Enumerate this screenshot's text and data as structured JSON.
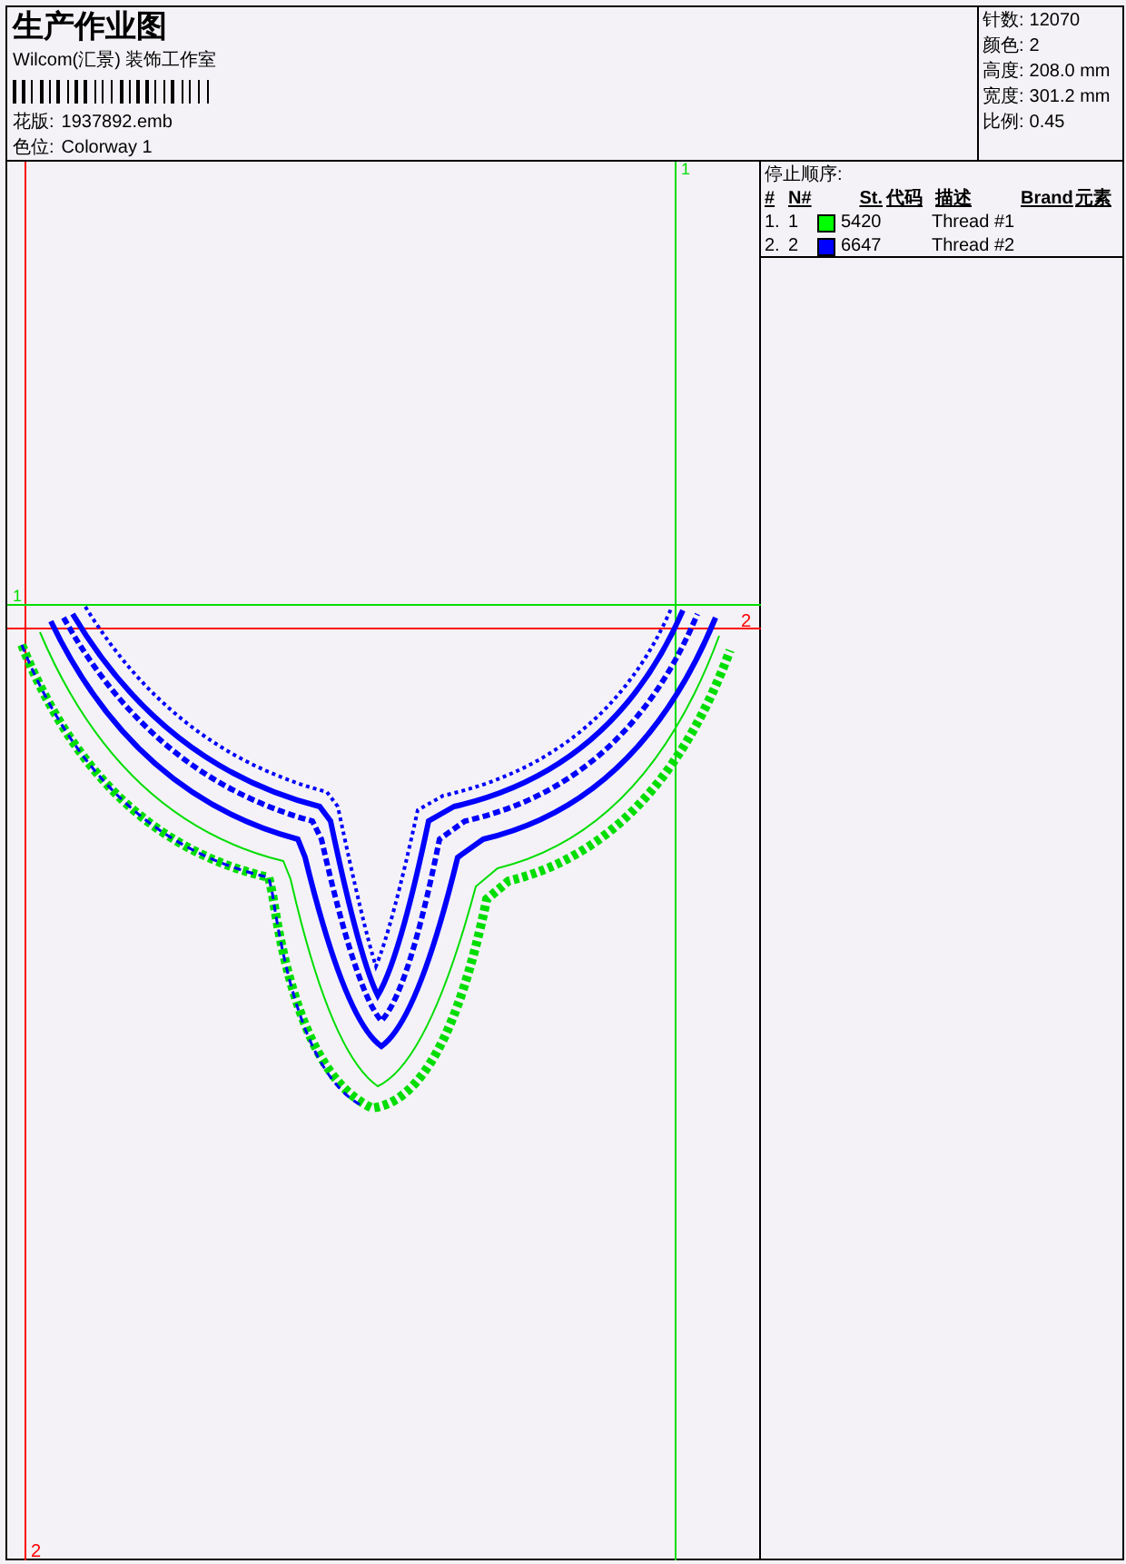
{
  "header": {
    "title": "生产作业图",
    "company": "Wilcom(汇景) 装饰工作室",
    "design_file": {
      "label": "花版:",
      "value": "1937892.emb"
    },
    "colorway": {
      "label": "色位:",
      "value": "Colorway 1"
    }
  },
  "stats": [
    {
      "label": "针数:",
      "value": "12070"
    },
    {
      "label": "颜色:",
      "value": "2"
    },
    {
      "label": "高度:",
      "value": "208.0 mm"
    },
    {
      "label": "宽度:",
      "value": "301.2 mm"
    },
    {
      "label": "比例:",
      "value": "0.45"
    }
  ],
  "guide_labels": [
    "1",
    "1",
    "2",
    "2"
  ],
  "stop_sequence": {
    "title": "停止顺序:",
    "columns": [
      "#",
      "N#",
      "St.",
      "代码",
      "描述",
      "Brand",
      "元素"
    ],
    "rows": [
      {
        "index": "1.",
        "n": "1",
        "color": "#00ff00",
        "code": "5420",
        "description": "Thread #1"
      },
      {
        "index": "2.",
        "n": "2",
        "color": "#0000ff",
        "code": "6647",
        "description": "Thread #2"
      }
    ]
  }
}
